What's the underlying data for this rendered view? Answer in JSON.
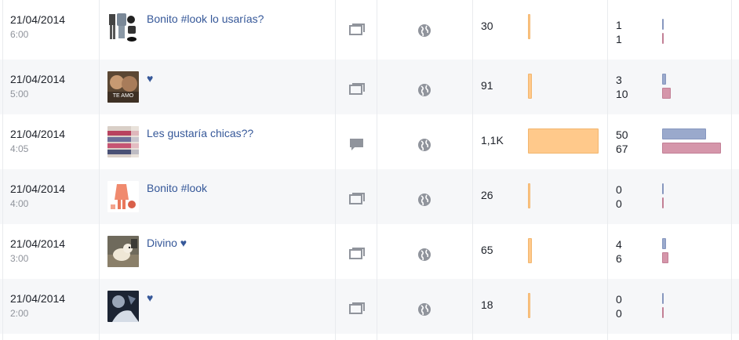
{
  "colors": {
    "link": "#365899",
    "reach_bar": "#ffc98b",
    "engagement_blue": "#9aa9cc",
    "engagement_pink": "#d596aa",
    "row_alt_bg": "#f6f7f9"
  },
  "rows": [
    {
      "date": "21/04/2014",
      "time": "6:00",
      "text": "Bonito #look lo usarías?",
      "type_icon": "photo-icon",
      "privacy_icon": "globe-icon",
      "thumb": "fashion-items-thumbnail",
      "reach": "30",
      "reach_fraction": 0.02,
      "engagement_top": "1",
      "engagement_bottom": "1",
      "eng_top_fraction": 0.02,
      "eng_bottom_fraction": 0.02
    },
    {
      "date": "21/04/2014",
      "time": "5:00",
      "text": "♥",
      "type_icon": "photo-icon",
      "privacy_icon": "globe-icon",
      "thumb": "te-amo-thumbnail",
      "thumb_label": "TE AMO",
      "reach": "91",
      "reach_fraction": 0.06,
      "engagement_top": "3",
      "engagement_bottom": "10",
      "eng_top_fraction": 0.06,
      "eng_bottom_fraction": 0.15
    },
    {
      "date": "21/04/2014",
      "time": "4:05",
      "text": "Les gustaría chicas??",
      "type_icon": "status-icon",
      "privacy_icon": "globe-icon",
      "thumb": "clothing-store-thumbnail",
      "reach": "1,1K",
      "reach_fraction": 1.0,
      "engagement_top": "50",
      "engagement_bottom": "67",
      "eng_top_fraction": 0.75,
      "eng_bottom_fraction": 1.0
    },
    {
      "date": "21/04/2014",
      "time": "4:00",
      "text": "Bonito #look",
      "type_icon": "photo-icon",
      "privacy_icon": "globe-icon",
      "thumb": "coral-outfit-thumbnail",
      "reach": "26",
      "reach_fraction": 0.02,
      "engagement_top": "0",
      "engagement_bottom": "0",
      "eng_top_fraction": 0.02,
      "eng_bottom_fraction": 0.02
    },
    {
      "date": "21/04/2014",
      "time": "3:00",
      "text": "Divino ♥",
      "type_icon": "photo-icon",
      "privacy_icon": "globe-icon",
      "thumb": "puppy-thumbnail",
      "reach": "65",
      "reach_fraction": 0.05,
      "engagement_top": "4",
      "engagement_bottom": "6",
      "eng_top_fraction": 0.07,
      "eng_bottom_fraction": 0.1
    },
    {
      "date": "21/04/2014",
      "time": "2:00",
      "text": "♥",
      "type_icon": "photo-icon",
      "privacy_icon": "globe-icon",
      "thumb": "dark-photo-thumbnail",
      "reach": "18",
      "reach_fraction": 0.02,
      "engagement_top": "0",
      "engagement_bottom": "0",
      "eng_top_fraction": 0.02,
      "eng_bottom_fraction": 0.02
    }
  ]
}
